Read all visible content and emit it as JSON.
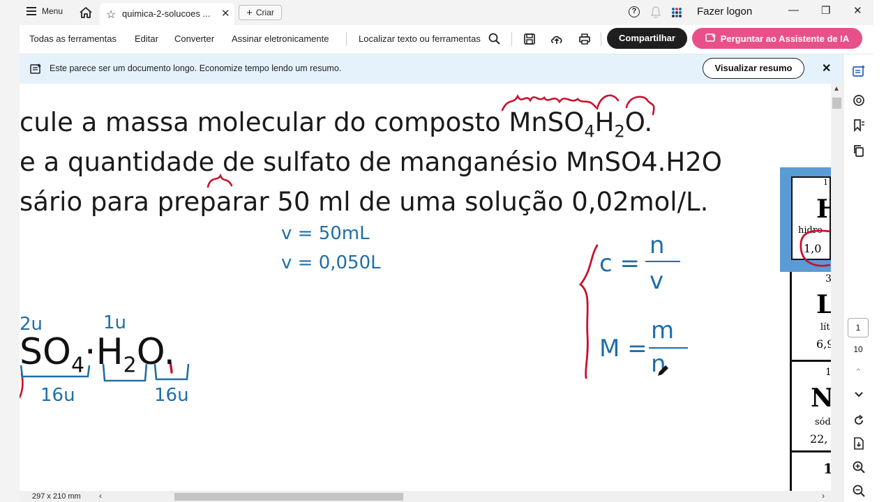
{
  "tabbar": {
    "menu_label": "Menu",
    "tab_title": "quimica-2-solucoes ...",
    "new_tab_label": "Criar",
    "signin_label": "Fazer logon"
  },
  "toolbar": {
    "all_tools": "Todas as ferramentas",
    "edit": "Editar",
    "convert": "Converter",
    "sign": "Assinar eletronicamente",
    "find": "Localizar texto ou ferramentas",
    "share": "Compartilhar",
    "ai_assistant": "Perguntar ao Assistente de IA"
  },
  "banner": {
    "message": "Este parece ser um documento longo. Economize tempo lendo um resumo.",
    "summary_button": "Visualizar resumo"
  },
  "document": {
    "line1_prefix": "cule a massa molecular do composto MnSO",
    "line1_sub1": "4",
    "line1_mid": "H",
    "line1_sub2": "2",
    "line1_suffix": "O.",
    "line2": "e a quantidade de sulfato de manganésio MnSO4.H2O",
    "line3": "sário para preparar 50 ml de uma solução 0,02mol/L.",
    "note_v1": "v =  50mL",
    "note_v2": "v = 0,050L",
    "formula_c_lhs": "c =",
    "formula_c_num": "n",
    "formula_c_den": "v",
    "formula_m_lhs": "M =",
    "formula_m_num": "m",
    "formula_m_den": "n",
    "formula_so": "SO",
    "formula_sub4": "4",
    "formula_dot1": "·",
    "formula_h": "H",
    "formula_sub2": "2",
    "formula_o": "O",
    "formula_dot2": ".",
    "mass_2u": "2u",
    "mass_1u": "1u",
    "mass_16u_a": "16u",
    "mass_16u_b": "16u"
  },
  "periodic_fragment": {
    "r1": "1",
    "r1_sym": "H",
    "r1_name": "hidro",
    "r1_mass": "1,0",
    "r2": "3",
    "r2_sym": "L",
    "r2_name": "lít",
    "r2_mass": "6,9",
    "r3": "1",
    "r3_sym": "N",
    "r3_name": "sód",
    "r3_mass": "22,",
    "r4": "1"
  },
  "status": {
    "page_size": "297 x 210 mm",
    "current_page": "1",
    "total_pages": "10"
  },
  "colors": {
    "accent_ai": "#e9508a",
    "share_bg": "#1e1e1e",
    "banner_bg": "#e5f2fb",
    "ink_blue": "#1f6ea9",
    "ink_red": "#c8102e"
  }
}
